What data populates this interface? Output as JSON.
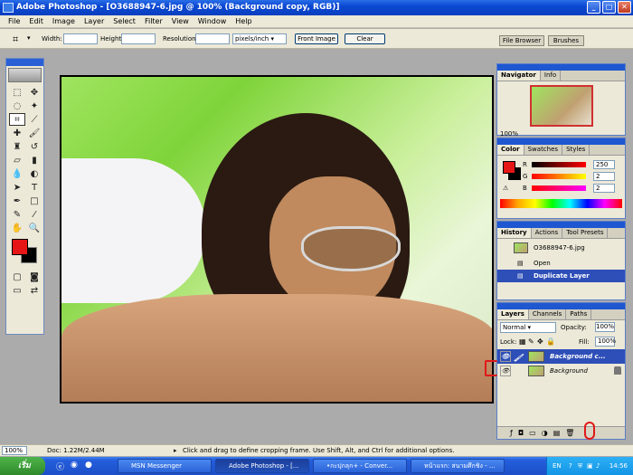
{
  "window": {
    "title": "Adobe Photoshop - [O3688947-6.jpg @ 100% (Background copy, RGB)]",
    "buttons": [
      "_",
      "□",
      "✕"
    ]
  },
  "menu": [
    "File",
    "Edit",
    "Image",
    "Layer",
    "Select",
    "Filter",
    "View",
    "Window",
    "Help"
  ],
  "options": {
    "width_label": "Width:",
    "height_label": "Height:",
    "resolution_label": "Resolution:",
    "resolution_unit": "pixels/inch",
    "front_image": "Front Image",
    "clear": "Clear",
    "file_browser": "File Browser",
    "brushes": "Brushes"
  },
  "navigator": {
    "tabs": [
      "Navigator",
      "Info"
    ],
    "zoom": "100%"
  },
  "color": {
    "tabs": [
      "Color",
      "Swatches",
      "Styles"
    ],
    "rows": [
      {
        "label": "R",
        "value": "250"
      },
      {
        "label": "G",
        "value": "2"
      },
      {
        "label": "B",
        "value": "2"
      }
    ],
    "foreground_color": "#e61616",
    "background_color": "#000000"
  },
  "history": {
    "tabs": [
      "History",
      "Actions",
      "Tool Presets"
    ],
    "snapshot": "O3688947-6.jpg",
    "items": [
      "Open",
      "Duplicate Layer"
    ]
  },
  "layers": {
    "tabs": [
      "Layers",
      "Channels",
      "Paths"
    ],
    "blend_mode": "Normal",
    "opacity_label": "Opacity:",
    "opacity_value": "100%",
    "lock_label": "Lock:",
    "fill_label": "Fill:",
    "fill_value": "100%",
    "items": [
      {
        "name": "Background c...",
        "selected": true
      },
      {
        "name": "Background",
        "selected": false
      }
    ]
  },
  "status": {
    "zoom": "100%",
    "doc": "Doc: 1.22M/2.44M",
    "hint": "Click and drag to define cropping frame. Use Shift, Alt, and Ctrl for additional options."
  },
  "taskbar": {
    "start": "เริ่ม",
    "tasks": [
      "MSN Messenger",
      "Adobe Photoshop - [...",
      "•กะปุกลุก+ - Conver...",
      "หน้าแรก: สนามศึกชิง - ..."
    ],
    "language": "EN",
    "time": "14:56"
  }
}
